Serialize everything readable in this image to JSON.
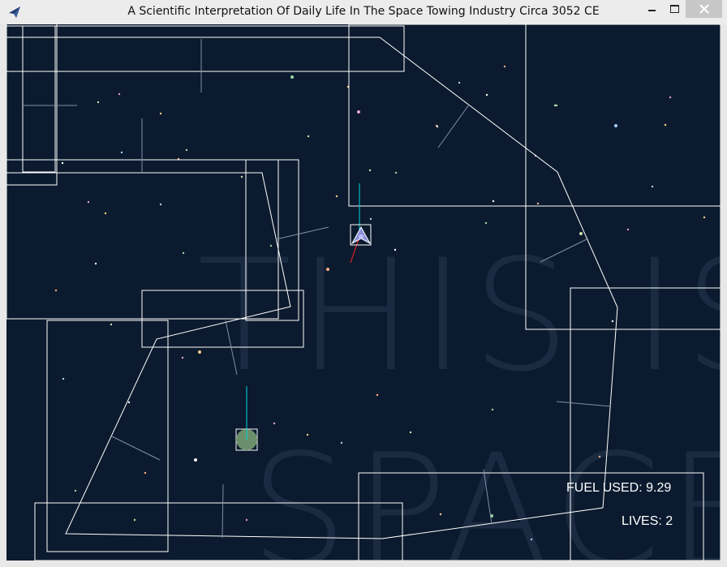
{
  "window": {
    "title": "A Scientific Interpretation Of Daily Life In The Space Towing Industry Circa 3052 CE",
    "icons": {
      "app": "paper-plane-icon",
      "minimize": "minimize-icon",
      "maximize": "maximize-icon",
      "close": "close-icon"
    }
  },
  "scene": {
    "background_color": "#0b1a2e",
    "watermark_line1": "THIS IS",
    "watermark_line2": "SPACE",
    "line_color": "#ffffff",
    "thruster_color": "#00d4e0",
    "heading_color": "#ff2020",
    "cargo_color": "#6b8f6b"
  },
  "hud": {
    "fuel_label": "FUEL USED:",
    "fuel_value": "9.29",
    "lives_label": "LIVES:",
    "lives_value": "2"
  }
}
